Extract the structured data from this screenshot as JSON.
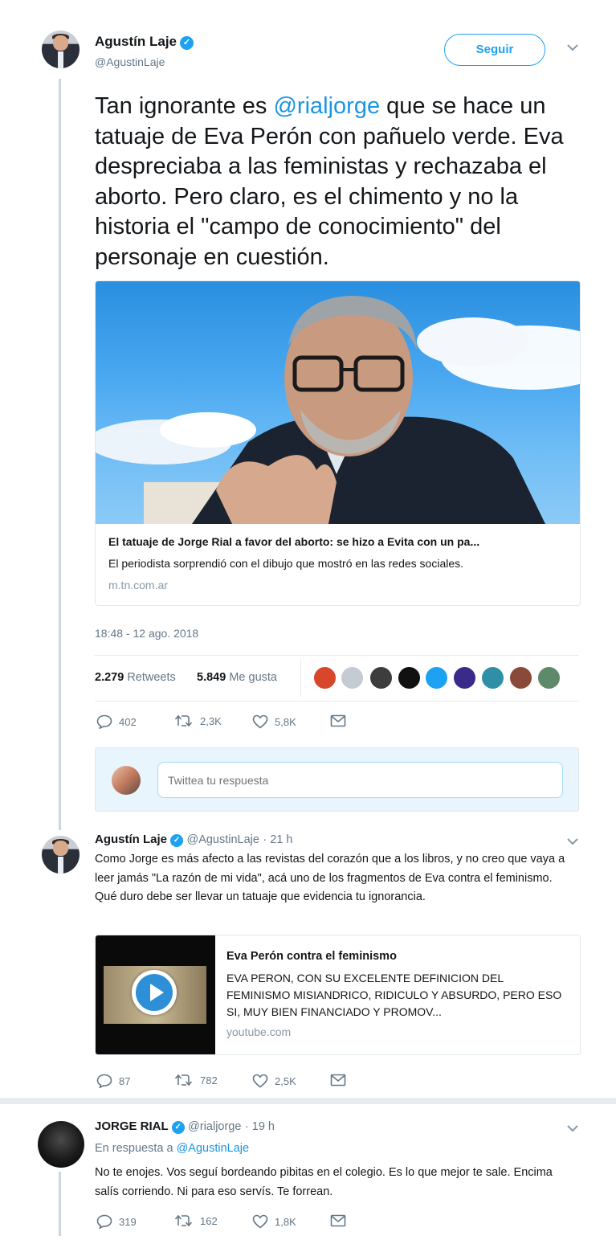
{
  "tweet": {
    "author_name": "Agustín Laje",
    "author_handle": "@AgustinLaje",
    "follow_label": "Seguir",
    "text_before": "Tan ignorante es ",
    "mention": "@rialjorge",
    "text_after": " que se hace un tatuaje de Eva Perón con pañuelo verde. Eva despreciaba a las feministas y rechazaba el aborto. Pero claro, es el chimento y no la historia el \"campo de conocimiento\" del personaje en cuestión.",
    "card": {
      "title": "El tatuaje de Jorge Rial a favor del aborto: se hizo a Evita con un pa...",
      "description": "El periodista sorprendió con el dibujo que mostró en las redes sociales.",
      "domain": "m.tn.com.ar"
    },
    "timestamp": "18:48 - 12 ago. 2018",
    "retweets_count": "2.279",
    "retweets_label": "Retweets",
    "likes_count": "5.849",
    "likes_label": "Me gusta",
    "actions": {
      "replies": "402",
      "retweets": "2,3K",
      "likes": "5,8K"
    }
  },
  "reply_box": {
    "placeholder": "Twittea tu respuesta"
  },
  "reply1": {
    "author_name": "Agustín Laje",
    "author_handle": "@AgustinLaje",
    "time": "· 21 h",
    "text": "Como Jorge es más afecto a las revistas del corazón que a los libros, y no creo que vaya a leer jamás \"La razón de mi vida\", acá uno de los fragmentos de Eva contra el feminismo. Qué duro debe ser llevar un tatuaje que evidencia tu ignorancia.",
    "card": {
      "title": "Eva Perón contra el feminismo",
      "description": "EVA PERON, CON SU EXCELENTE DEFINICION DEL FEMINISMO MISIANDRICO, RIDICULO Y ABSURDO, PERO ESO SI, MUY BIEN FINANCIADO Y PROMOV...",
      "domain": "youtube.com"
    },
    "actions": {
      "replies": "87",
      "retweets": "782",
      "likes": "2,5K"
    }
  },
  "reply2": {
    "author_name": "JORGE RIAL",
    "author_handle": "@rialjorge",
    "time": "· 19 h",
    "in_reply_prefix": "En respuesta a ",
    "in_reply_handle": "@AgustinLaje",
    "text": "No te enojes. Vos seguí bordeando pibitas en el colegio. Es lo que mejor te sale. Encima salís corriendo. Ni para eso servís. Te forrean.",
    "actions": {
      "replies": "319",
      "retweets": "162",
      "likes": "1,8K"
    }
  },
  "colors": {
    "link": "#1b95e0",
    "accent": "#1da1f2",
    "muted": "#657786"
  }
}
